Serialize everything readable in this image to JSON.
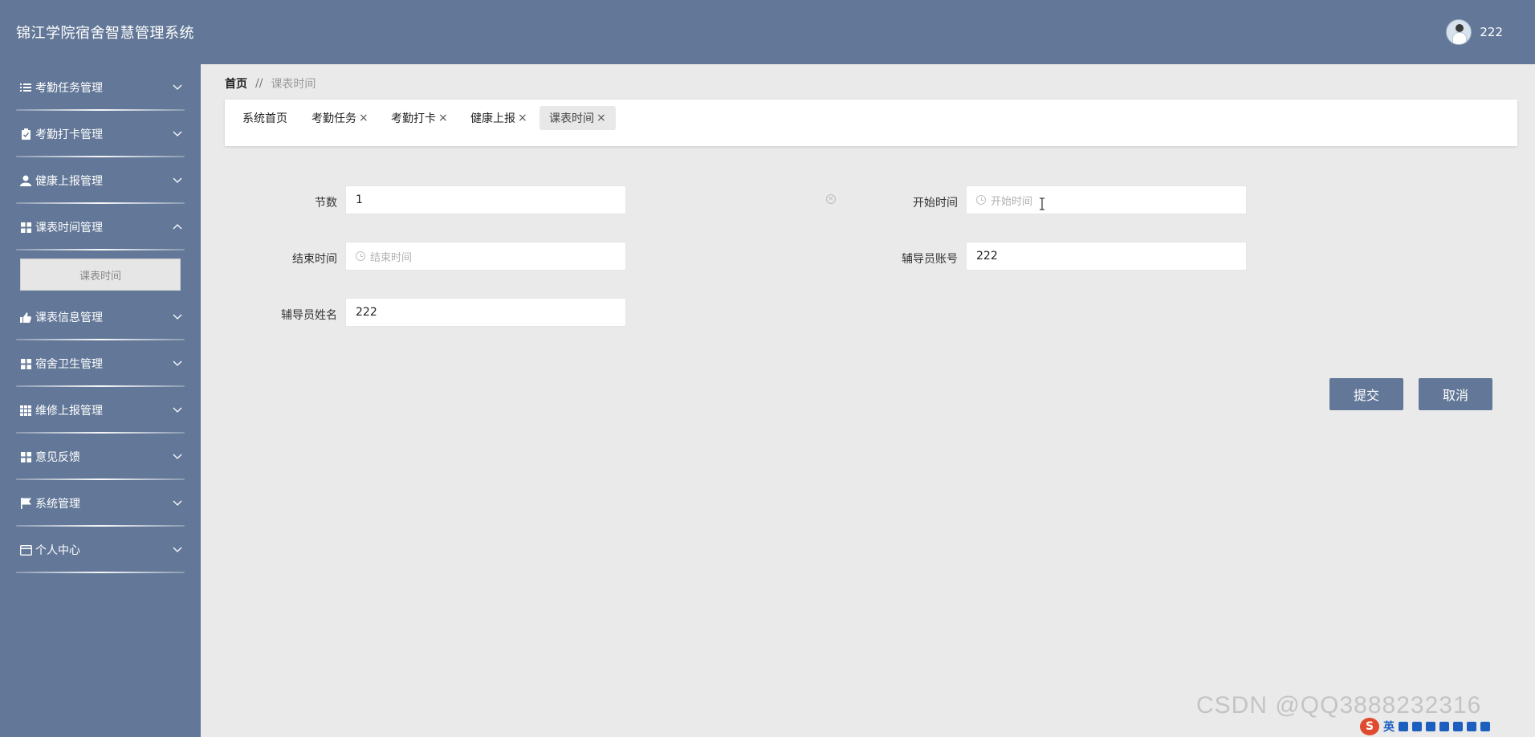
{
  "header": {
    "title": "锦江学院宿舍智慧管理系统",
    "username": "222"
  },
  "sidebar": {
    "items": [
      {
        "label": "考勤任务管理",
        "icon": "list-icon",
        "expanded": false
      },
      {
        "label": "考勤打卡管理",
        "icon": "clipboard-icon",
        "expanded": false
      },
      {
        "label": "健康上报管理",
        "icon": "user-icon",
        "expanded": false
      },
      {
        "label": "课表时间管理",
        "icon": "grid-icon",
        "expanded": true
      },
      {
        "label": "课表信息管理",
        "icon": "hand-icon",
        "expanded": false
      },
      {
        "label": "宿舍卫生管理",
        "icon": "grid-icon",
        "expanded": false
      },
      {
        "label": "维修上报管理",
        "icon": "table-icon",
        "expanded": false
      },
      {
        "label": "意见反馈",
        "icon": "grid-icon",
        "expanded": false
      },
      {
        "label": "系统管理",
        "icon": "flag-icon",
        "expanded": false
      },
      {
        "label": "个人中心",
        "icon": "card-icon",
        "expanded": false
      }
    ],
    "submenu": {
      "label": "课表时间"
    }
  },
  "breadcrumb": {
    "home": "首页",
    "separator": "//",
    "current": "课表时间"
  },
  "tabs": [
    {
      "label": "系统首页",
      "closable": false,
      "active": false
    },
    {
      "label": "考勤任务",
      "closable": true,
      "active": false
    },
    {
      "label": "考勤打卡",
      "closable": true,
      "active": false
    },
    {
      "label": "健康上报",
      "closable": true,
      "active": false
    },
    {
      "label": "课表时间",
      "closable": true,
      "active": true
    }
  ],
  "tab_close_glyph": "×",
  "form": {
    "section_number": {
      "label": "节数",
      "value": "1"
    },
    "start_time": {
      "label": "开始时间",
      "placeholder": "开始时间"
    },
    "end_time": {
      "label": "结束时间",
      "placeholder": "结束时间"
    },
    "counselor_account": {
      "label": "辅导员账号",
      "value": "222"
    },
    "counselor_name": {
      "label": "辅导员姓名",
      "value": "222"
    }
  },
  "buttons": {
    "submit": "提交",
    "cancel": "取消"
  },
  "watermark": "CSDN @QQ3888232316",
  "ime": {
    "logo": "S",
    "mode": "英"
  },
  "colors": {
    "primary": "#637898",
    "background": "#eaeaea"
  }
}
